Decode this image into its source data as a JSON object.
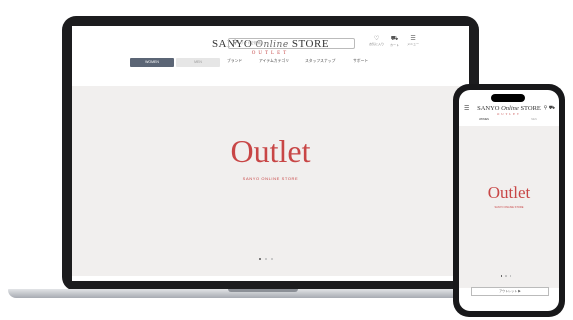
{
  "laptop": {
    "logo": {
      "left": "SANYO",
      "script": "Online",
      "right": "STORE",
      "sub": "OUTLET"
    },
    "search": {
      "placeholder": "キーワードで検索",
      "icon": "search-icon"
    },
    "header_icons": [
      {
        "icon": "heart-icon",
        "label": "お気に入り"
      },
      {
        "icon": "cart-icon",
        "label": "カート"
      },
      {
        "icon": "menu-icon",
        "label": "メニュー"
      }
    ],
    "tabs": [
      "WOMEN",
      "MEN"
    ],
    "nav": [
      "ブランド",
      "アイテムカテゴリ",
      "スタッフスナップ",
      "サポート"
    ],
    "hero": {
      "title": "Outlet",
      "subtitle": "SANYO ONLINE STORE"
    },
    "carousel": {
      "count": 3,
      "active": 1
    }
  },
  "phone": {
    "logo": {
      "left": "SANYO",
      "script": "Online",
      "right": "STORE",
      "sub": "OUTLET"
    },
    "tabs": [
      "WOMEN",
      "MEN"
    ],
    "hero": {
      "title": "Outlet",
      "subtitle": "SANYO ONLINE STORE"
    },
    "carousel": {
      "count": 3,
      "active": 1
    },
    "button": "アウトレット ▶"
  },
  "colors": {
    "accent": "#c84646",
    "tab_active": "#5b6575",
    "device": "#1c1c1e"
  }
}
